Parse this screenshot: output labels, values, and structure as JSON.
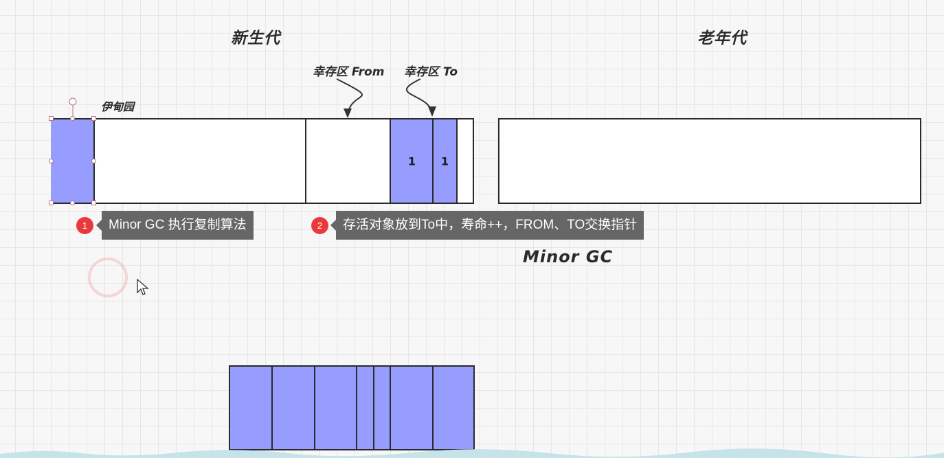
{
  "diagram": {
    "young_gen_title": "新生代",
    "old_gen_title": "老年代",
    "eden_label": "伊甸园",
    "survivor_from_label": "幸存区 From",
    "survivor_to_label": "幸存区 To",
    "cell_values": [
      "1",
      "1"
    ],
    "minor_gc_label": "Minor GC"
  },
  "annotations": [
    {
      "index": "1",
      "text": "Minor GC 执行复制算法"
    },
    {
      "index": "2",
      "text": "存活对象放到To中，寿命++，FROM、TO交换指针"
    }
  ],
  "colors": {
    "object_fill": "#979cff",
    "tooltip_bg": "#666666",
    "badge_red": "#e8393d"
  }
}
